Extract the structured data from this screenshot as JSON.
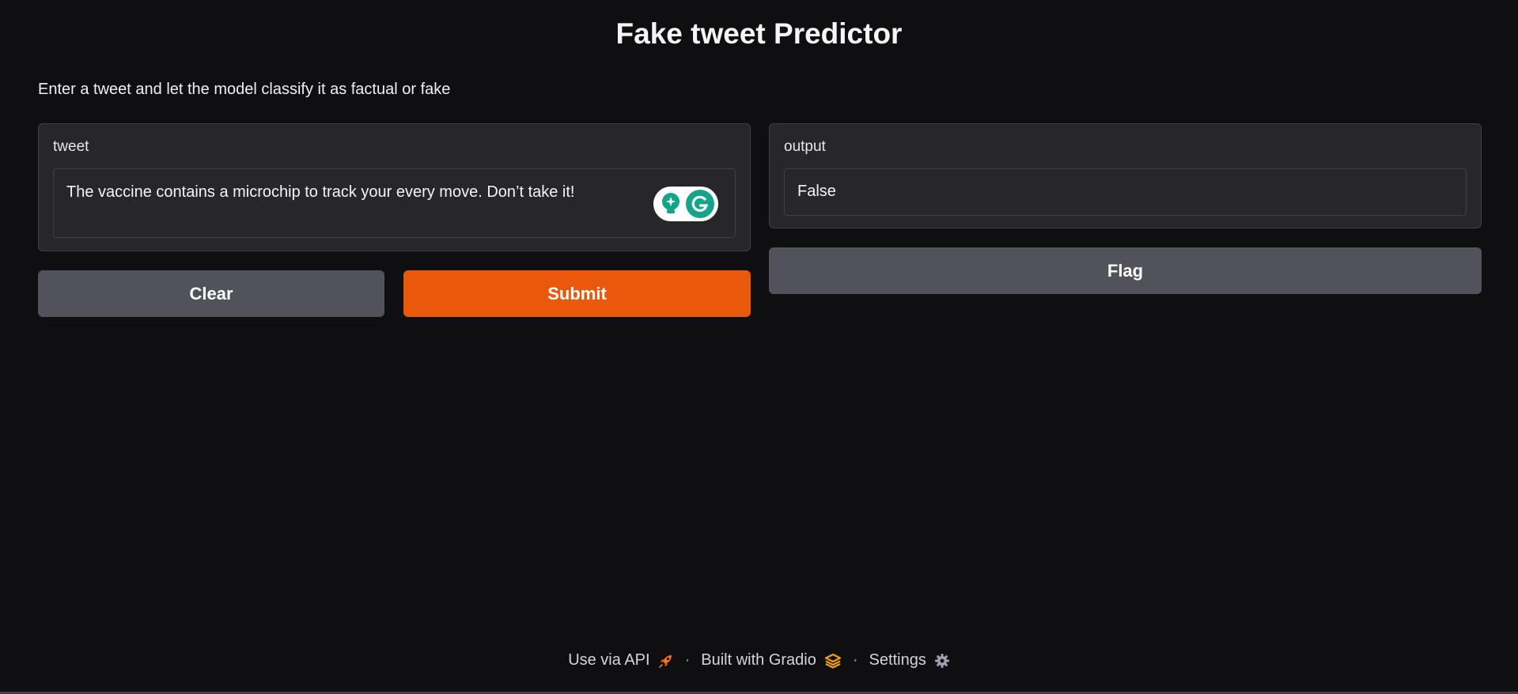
{
  "header": {
    "title": "Fake tweet Predictor",
    "description": "Enter a tweet and let the model classify it as factual or fake"
  },
  "input_panel": {
    "label": "tweet",
    "value": "The vaccine contains a microchip to track your every move. Don’t take it!"
  },
  "output_panel": {
    "label": "output",
    "value": "False"
  },
  "buttons": {
    "clear": "Clear",
    "submit": "Submit",
    "flag": "Flag"
  },
  "footer": {
    "api": "Use via API",
    "built_with": "Built with Gradio",
    "settings": "Settings",
    "separator": "·"
  },
  "colors": {
    "background": "#0f0f11",
    "panel": "#27272a",
    "primary_button": "#ea580c",
    "secondary_button": "#52525b",
    "grammarly_green": "#15a38a"
  },
  "icons": {
    "api": "rocket-icon",
    "gradio": "gradio-logo-icon",
    "settings": "gear-icon",
    "grammarly": "grammarly-icon"
  }
}
